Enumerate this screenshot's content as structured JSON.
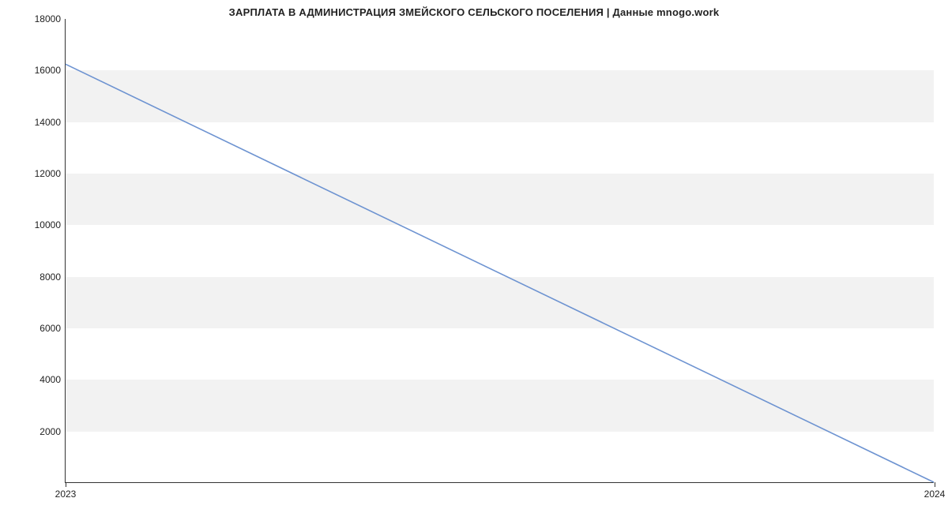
{
  "chart_data": {
    "type": "line",
    "title": "ЗАРПЛАТА В АДМИНИСТРАЦИЯ ЗМЕЙСКОГО СЕЛЬСКОГО ПОСЕЛЕНИЯ | Данные mnogo.work",
    "xlabel": "",
    "ylabel": "",
    "x": [
      2023,
      2024
    ],
    "values": [
      16242,
      0
    ],
    "x_ticks": [
      2023,
      2024
    ],
    "y_ticks": [
      2000,
      4000,
      6000,
      8000,
      10000,
      12000,
      14000,
      16000,
      18000
    ],
    "ylim": [
      0,
      18000
    ],
    "line_color": "#6d93d1"
  }
}
